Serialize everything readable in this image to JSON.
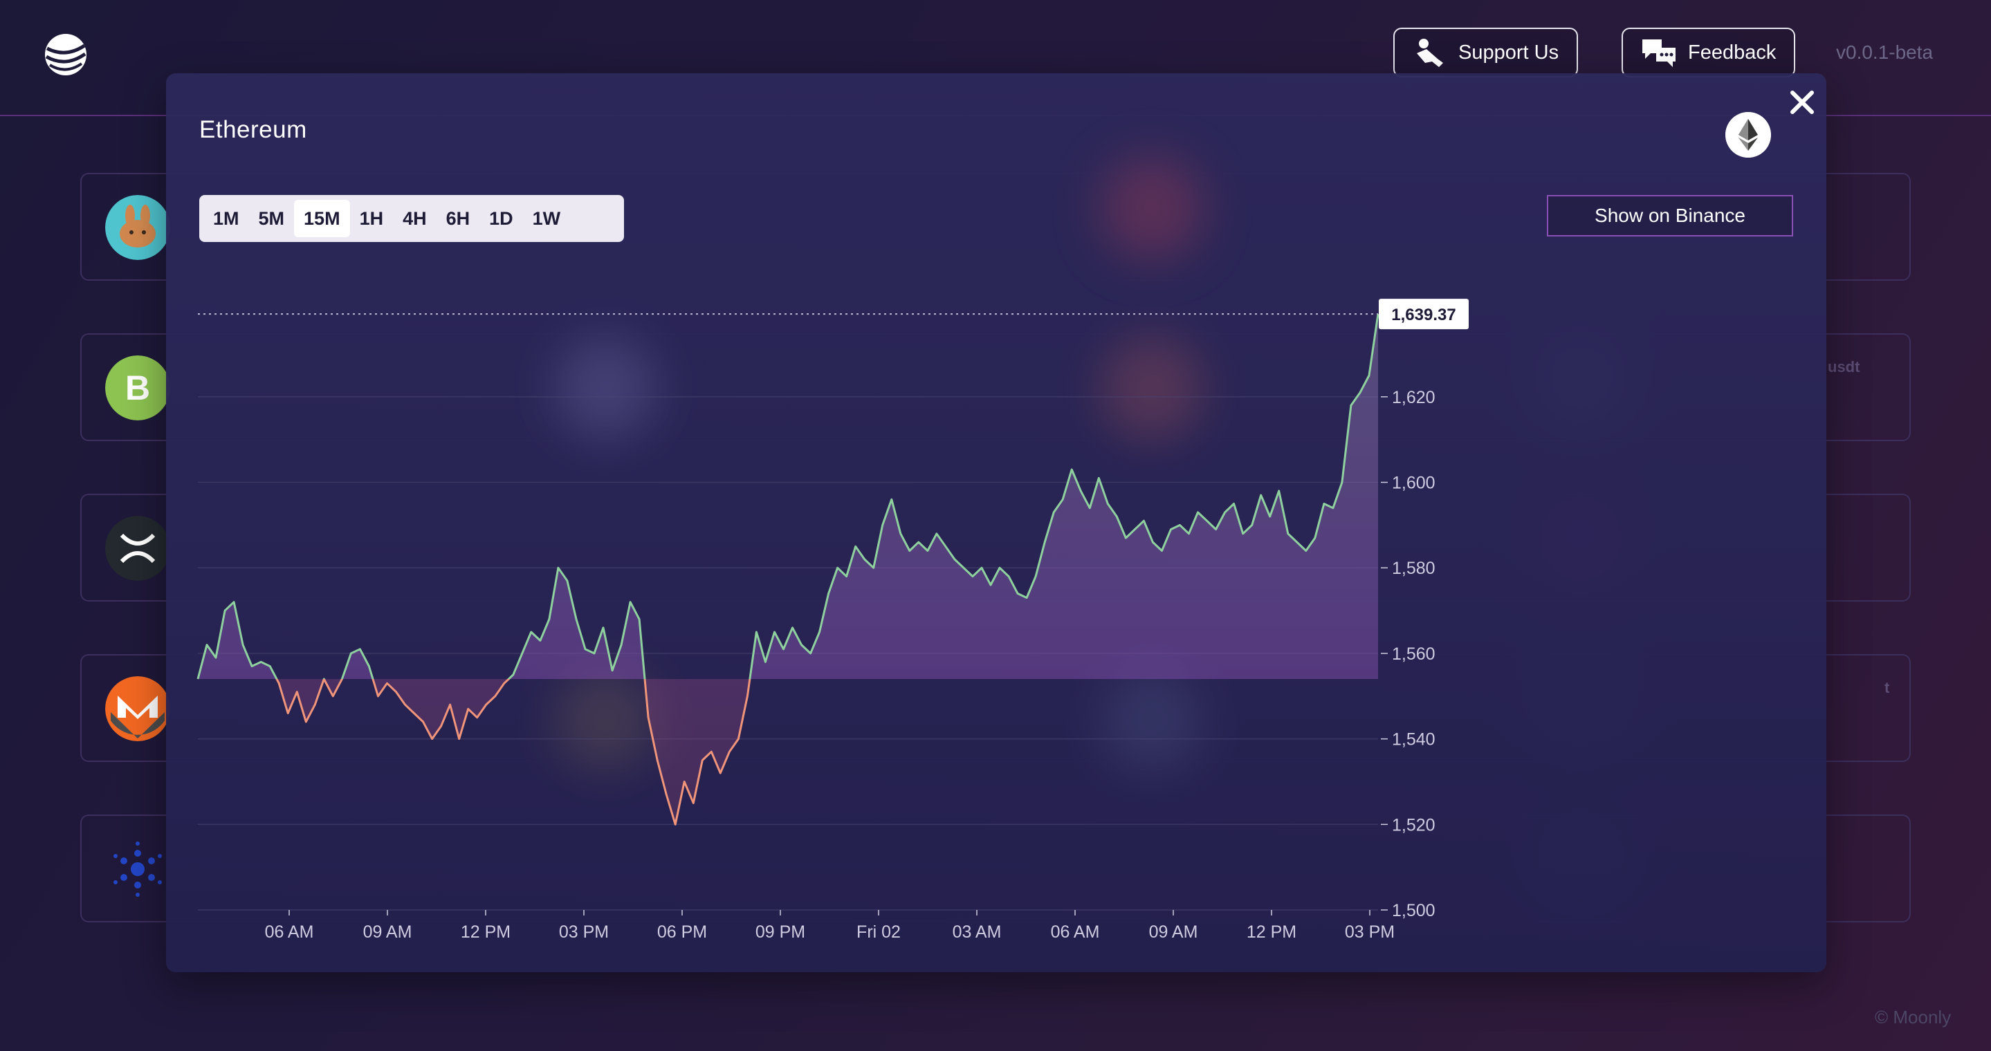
{
  "header": {
    "support_label": "Support Us",
    "feedback_label": "Feedback",
    "version": "v0.0.1-beta"
  },
  "footer": {
    "copyright": "© Moonly"
  },
  "background_rows": [
    {
      "icon": "pancakeswap-bunny-icon",
      "color": "#4fc4cf"
    },
    {
      "icon": "bitcoin-cash-icon",
      "color": "#8dc351",
      "side_text": "usdt"
    },
    {
      "icon": "xrp-icon",
      "color": "#23292f"
    },
    {
      "icon": "monero-icon",
      "color": "#f26822",
      "side_text": "t"
    },
    {
      "icon": "cardano-icon",
      "color": "#1f3fa8"
    }
  ],
  "modal": {
    "title": "Ethereum",
    "timeframes": [
      "1M",
      "5M",
      "15M",
      "1H",
      "4H",
      "6H",
      "1D",
      "1W"
    ],
    "active_timeframe": "15M",
    "binance_label": "Show on Binance"
  },
  "chart_data": {
    "type": "area",
    "baseline": 1554,
    "last_value": 1639.37,
    "last_value_label": "1,639.37",
    "ylim": [
      1500,
      1641
    ],
    "yticks": [
      1500,
      1520,
      1540,
      1560,
      1580,
      1600,
      1620
    ],
    "ytick_labels": [
      "1,500",
      "1,520",
      "1,540",
      "1,560",
      "1,580",
      "1,600",
      "1,620"
    ],
    "xticks": [
      "06 AM",
      "09 AM",
      "12 PM",
      "03 PM",
      "06 PM",
      "09 PM",
      "Fri 02",
      "03 AM",
      "06 AM",
      "09 AM",
      "12 PM",
      "03 PM"
    ],
    "colors": {
      "up": "#8fd19e",
      "down": "#f0957a",
      "fill": "#7a3aa8",
      "text": "#cfcbe0"
    },
    "values": [
      1554,
      1562,
      1559,
      1570,
      1572,
      1562,
      1557,
      1558,
      1557,
      1553,
      1546,
      1551,
      1544,
      1548,
      1554,
      1550,
      1554,
      1560,
      1561,
      1557,
      1550,
      1553,
      1551,
      1548,
      1546,
      1544,
      1540,
      1543,
      1548,
      1540,
      1547,
      1545,
      1548,
      1550,
      1553,
      1555,
      1560,
      1565,
      1563,
      1568,
      1580,
      1577,
      1568,
      1561,
      1560,
      1566,
      1556,
      1562,
      1572,
      1568,
      1545,
      1535,
      1527,
      1520,
      1530,
      1525,
      1535,
      1537,
      1532,
      1537,
      1540,
      1550,
      1565,
      1558,
      1565,
      1561,
      1566,
      1562,
      1560,
      1565,
      1574,
      1580,
      1578,
      1585,
      1582,
      1580,
      1590,
      1596,
      1588,
      1584,
      1586,
      1584,
      1588,
      1585,
      1582,
      1580,
      1578,
      1580,
      1576,
      1580,
      1578,
      1574,
      1573,
      1578,
      1586,
      1593,
      1596,
      1603,
      1598,
      1594,
      1601,
      1595,
      1592,
      1587,
      1589,
      1591,
      1586,
      1584,
      1589,
      1590,
      1588,
      1593,
      1591,
      1589,
      1593,
      1595,
      1588,
      1590,
      1597,
      1592,
      1598,
      1588,
      1586,
      1584,
      1587,
      1595,
      1594,
      1600,
      1618,
      1621,
      1625,
      1639.37
    ]
  }
}
